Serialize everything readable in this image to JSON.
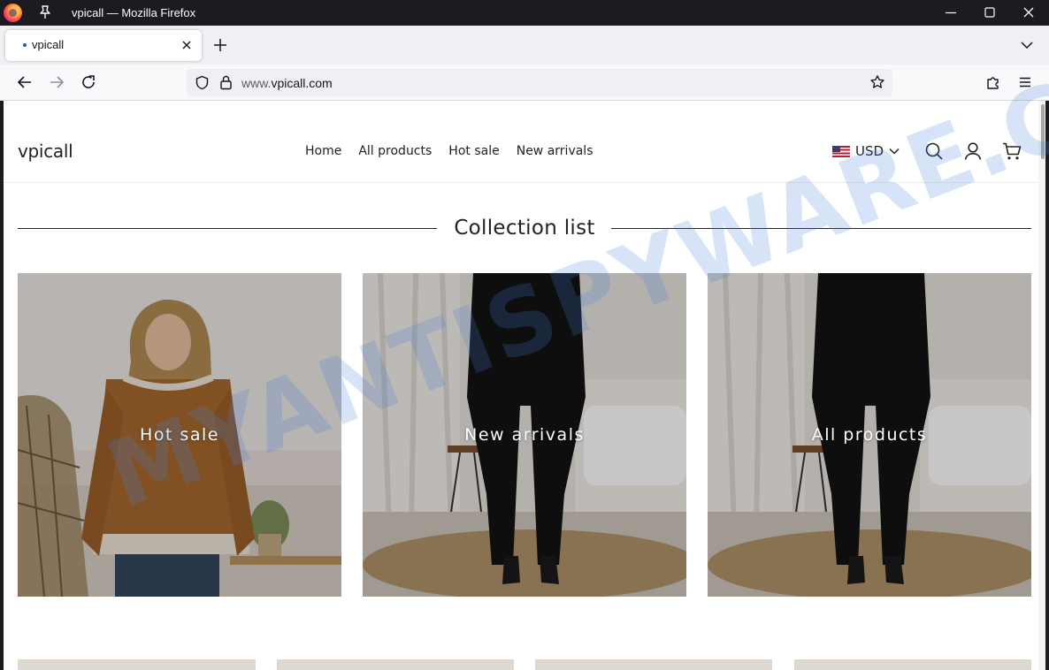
{
  "window": {
    "title": "vpicall — Mozilla Firefox"
  },
  "tab": {
    "title": "vpicall"
  },
  "urlbar": {
    "host_prefix": "www.",
    "host": "vpicall.com"
  },
  "site": {
    "logo": "vpicall",
    "menu": [
      "Home",
      "All products",
      "Hot sale",
      "New arrivals"
    ],
    "currency": "USD"
  },
  "section": {
    "title": "Collection list"
  },
  "collections": [
    {
      "label": "Hot sale"
    },
    {
      "label": "New arrivals"
    },
    {
      "label": "All products"
    }
  ],
  "watermark": {
    "text": "MYANTISPYWARE.COM"
  },
  "colors": {
    "chrome_dark": "#1c1b22",
    "tabstrip": "#f0f0f4",
    "text": "#222222",
    "watermark": "#4a7fd8"
  },
  "icons": [
    "firefox-logo",
    "pin-icon",
    "minimize-icon",
    "maximize-icon",
    "close-icon",
    "tab-close-icon",
    "new-tab-icon",
    "tab-list-icon",
    "back-icon",
    "forward-icon",
    "reload-icon",
    "shield-icon",
    "lock-icon",
    "bookmark-star-icon",
    "extensions-icon",
    "app-menu-icon",
    "flag-us-icon",
    "chevron-down-icon",
    "search-icon",
    "account-icon",
    "cart-icon"
  ]
}
